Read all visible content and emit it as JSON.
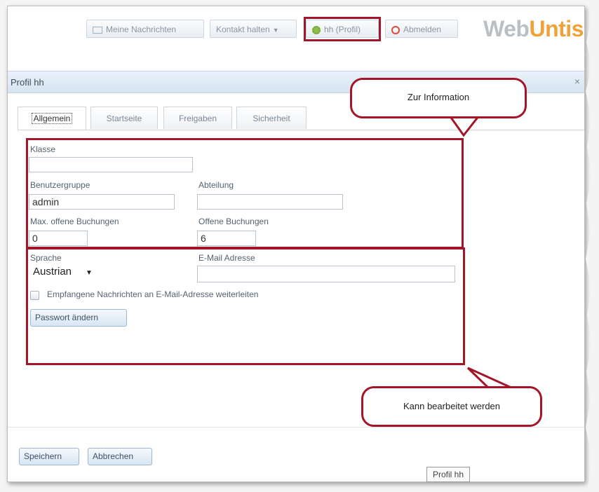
{
  "toolbar": {
    "messages_label": "Meine Nachrichten",
    "contact_label": "Kontakt halten",
    "profile_label": "hh (Profil)",
    "logout_label": "Abmelden",
    "messages_icon": "envelope-icon",
    "profile_icon": "gear-icon",
    "logout_icon": "power-icon"
  },
  "logo": {
    "part1": "Web",
    "part2": "Untis",
    "color1": "#b9bfc5",
    "color2": "#f0a23a"
  },
  "dialog": {
    "title": "Profil hh",
    "close_glyph": "×"
  },
  "tabs": [
    "Allgemein",
    "Startseite",
    "Freigaben",
    "Sicherheit"
  ],
  "form": {
    "klasse_label": "Klasse",
    "klasse_value": "",
    "benutzergruppe_label": "Benutzergruppe",
    "benutzergruppe_value": "admin",
    "abteilung_label": "Abteilung",
    "abteilung_value": "",
    "max_buchungen_label": "Max. offene Buchungen",
    "max_buchungen_value": "0",
    "offene_buchungen_label": "Offene Buchungen",
    "offene_buchungen_value": "6",
    "sprache_label": "Sprache",
    "sprache_value": "Austrian",
    "email_label": "E-Mail Adresse",
    "email_value": "",
    "forward_label": "Empfangene Nachrichten an E-Mail-Adresse weiterleiten",
    "password_button": "Passwort ändern"
  },
  "callouts": {
    "info": "Zur Information",
    "editable": "Kann bearbeitet werden"
  },
  "footer": {
    "save": "Speichern",
    "cancel": "Abbrechen"
  },
  "tooltip": "Profil hh",
  "colors": {
    "highlight": "#a3162a",
    "titlebar": "#d6e4f1"
  }
}
